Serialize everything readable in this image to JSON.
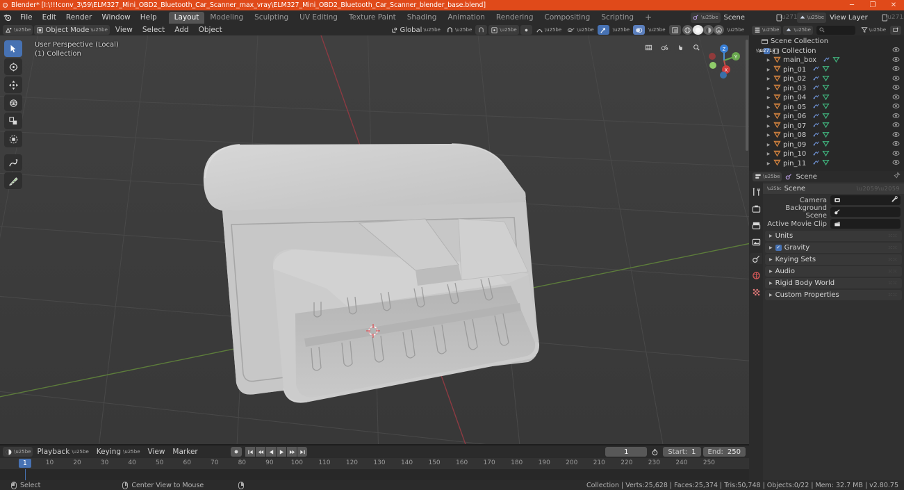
{
  "titlebar": {
    "app_title": "Blender* [I:\\!!!conv_3\\59\\ELM327_Mini_OBD2_Bluetooth_Car_Scanner_max_vray\\ELM327_Mini_OBD2_Bluetooth_Car_Scanner_blender_base.blend]",
    "accent_color": "#e04a1a",
    "minimize": "─",
    "maximize": "❐",
    "close": "✕"
  },
  "topbar": {
    "menus": [
      "File",
      "Edit",
      "Render",
      "Window",
      "Help"
    ],
    "workspaces": [
      {
        "label": "Layout",
        "active": true
      },
      {
        "label": "Modeling",
        "active": false
      },
      {
        "label": "Sculpting",
        "active": false
      },
      {
        "label": "UV Editing",
        "active": false
      },
      {
        "label": "Texture Paint",
        "active": false
      },
      {
        "label": "Shading",
        "active": false
      },
      {
        "label": "Animation",
        "active": false
      },
      {
        "label": "Rendering",
        "active": false
      },
      {
        "label": "Compositing",
        "active": false
      },
      {
        "label": "Scripting",
        "active": false
      }
    ],
    "add_workspace": "+",
    "scene_name": "Scene",
    "view_layer_name": "View Layer",
    "new_scene_icon": "new-scene-icon",
    "unlink_scene_icon": "unlink-icon"
  },
  "viewport_header": {
    "mode": "Object Mode",
    "menus": [
      "View",
      "Select",
      "Add",
      "Object"
    ],
    "transform_orientation": "Global",
    "snap_icon": "magnet-icon",
    "pivot_icon": "pivot-icon",
    "proportional_icon": "proportional-edit-icon"
  },
  "viewport": {
    "overlay_line1": "User Perspective (Local)",
    "overlay_line2": "(1) Collection",
    "tools": [
      {
        "name": "tweak-tool",
        "active": true
      },
      {
        "name": "cursor-tool",
        "active": false
      },
      {
        "name": "move-tool",
        "active": false
      },
      {
        "name": "rotate-tool",
        "active": false
      },
      {
        "name": "scale-tool",
        "active": false
      },
      {
        "name": "transform-tool",
        "active": false
      },
      {
        "name": "annotate-tool",
        "active": false
      },
      {
        "name": "measure-tool",
        "active": false
      }
    ],
    "nav_icons": [
      "camera-view-icon",
      "camera-icon",
      "pan-view-icon",
      "zoom-view-icon"
    ],
    "gizmo_axes": [
      "Z",
      "Y",
      "X"
    ],
    "background_color": "#3b3b3b",
    "model_color": "#c8c8c8"
  },
  "outliner": {
    "search_placeholder": "",
    "root": "Scene Collection",
    "collection": "Collection",
    "items": [
      {
        "label": "main_box"
      },
      {
        "label": "pin_01"
      },
      {
        "label": "pin_02"
      },
      {
        "label": "pin_03"
      },
      {
        "label": "pin_04"
      },
      {
        "label": "pin_05"
      },
      {
        "label": "pin_06"
      },
      {
        "label": "pin_07"
      },
      {
        "label": "pin_08"
      },
      {
        "label": "pin_09"
      },
      {
        "label": "pin_10"
      },
      {
        "label": "pin_11"
      }
    ]
  },
  "properties": {
    "breadcrumb": "Scene",
    "panel_scene": "Scene",
    "rows": [
      {
        "label": "Camera",
        "value": "",
        "icon": "camera-icon",
        "eyedropper": true
      },
      {
        "label": "Background Scene",
        "value": "",
        "icon": "scene-icon",
        "eyedropper": false
      },
      {
        "label": "Active Movie Clip",
        "value": "",
        "icon": "clapperboard-icon",
        "eyedropper": false
      }
    ],
    "panels": [
      {
        "label": "Units",
        "checkbox": false
      },
      {
        "label": "Gravity",
        "checkbox": true
      },
      {
        "label": "Keying Sets",
        "checkbox": false
      },
      {
        "label": "Audio",
        "checkbox": false
      },
      {
        "label": "Rigid Body World",
        "checkbox": false
      },
      {
        "label": "Custom Properties",
        "checkbox": false
      }
    ],
    "tabs": [
      {
        "name": "tool-tab",
        "active": false
      },
      {
        "name": "render-tab",
        "active": false
      },
      {
        "name": "output-tab",
        "active": false
      },
      {
        "name": "view-layer-tab",
        "active": false
      },
      {
        "name": "scene-tab",
        "active": true
      },
      {
        "name": "world-tab",
        "active": false
      },
      {
        "name": "texture-tab",
        "active": false
      }
    ]
  },
  "timeline": {
    "menus": [
      "Playback",
      "Keying",
      "View",
      "Marker"
    ],
    "current_frame": "1",
    "start_label": "Start:",
    "start_value": "1",
    "end_label": "End:",
    "end_value": "250",
    "ticks": [
      10,
      20,
      30,
      40,
      50,
      60,
      70,
      80,
      90,
      100,
      110,
      120,
      130,
      140,
      150,
      160,
      170,
      180,
      190,
      200,
      210,
      220,
      230,
      240,
      250
    ],
    "playhead_frame": "1",
    "playhead_color": "#4772b3",
    "transport": [
      "jump-start-icon",
      "prev-keyframe-icon",
      "play-reverse-icon",
      "play-icon",
      "next-keyframe-icon",
      "jump-end-icon"
    ],
    "record_icon": "record-icon",
    "autokey_icon": "stopwatch-icon"
  },
  "statusbar": {
    "left_action": "Select",
    "mid_action": "Center View to Mouse",
    "stats": "Collection | Verts:25,628 | Faces:25,374 | Tris:50,748 | Objects:0/22 | Mem: 32.7 MB | v2.80.75"
  }
}
